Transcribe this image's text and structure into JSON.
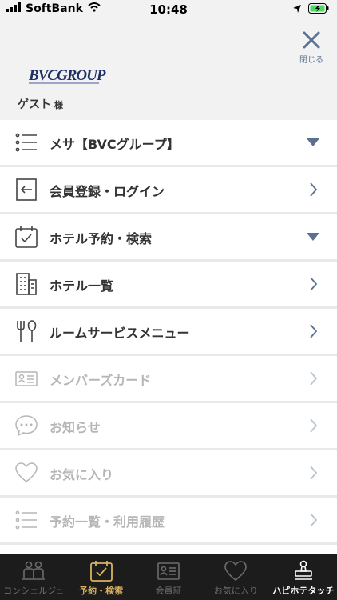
{
  "status_bar": {
    "carrier": "SoftBank",
    "time": "10:48"
  },
  "header": {
    "close_label": "閉じる",
    "logo_text": "BVCGROUP",
    "guest_name": "ゲスト",
    "guest_suffix": "様"
  },
  "menu": {
    "items": [
      {
        "label": "メサ【BVCグループ】",
        "icon": "list-icon",
        "trailing": "triangle-down",
        "disabled": false
      },
      {
        "label": "会員登録・ログイン",
        "icon": "login-icon",
        "trailing": "chevron-right",
        "disabled": false
      },
      {
        "label": "ホテル予約・検索",
        "icon": "calendar-check-icon",
        "trailing": "triangle-down",
        "disabled": false
      },
      {
        "label": "ホテル一覧",
        "icon": "building-icon",
        "trailing": "chevron-right",
        "disabled": false
      },
      {
        "label": "ルームサービスメニュー",
        "icon": "fork-spoon-icon",
        "trailing": "chevron-right",
        "disabled": false
      },
      {
        "label": "メンバーズカード",
        "icon": "member-card-icon",
        "trailing": "chevron-right",
        "disabled": true
      },
      {
        "label": "お知らせ",
        "icon": "speech-bubble-icon",
        "trailing": "chevron-right",
        "disabled": true
      },
      {
        "label": "お気に入り",
        "icon": "heart-icon",
        "trailing": "chevron-right",
        "disabled": true
      },
      {
        "label": "予約一覧・利用履歴",
        "icon": "list-icon",
        "trailing": "chevron-right",
        "disabled": true
      }
    ]
  },
  "tabbar": {
    "tabs": [
      {
        "label": "コンシェルジュ",
        "icon": "concierge-icon",
        "state": "inactive"
      },
      {
        "label": "予約・検索",
        "icon": "calendar-check-icon",
        "state": "active"
      },
      {
        "label": "会員証",
        "icon": "member-card-icon",
        "state": "inactive"
      },
      {
        "label": "お気に入り",
        "icon": "heart-icon",
        "state": "inactive"
      },
      {
        "label": "ハピホテタッチ",
        "icon": "stamp-icon",
        "state": "white"
      }
    ]
  },
  "colors": {
    "accent": "#5a7191",
    "active_tab": "#d8b260",
    "tabbar_bg": "#1c1c1c",
    "disabled_text": "#b6b6b6"
  }
}
